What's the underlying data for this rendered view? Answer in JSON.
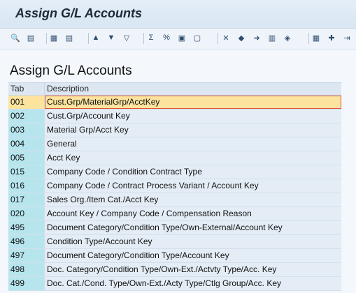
{
  "window": {
    "title": "Assign G/L Accounts"
  },
  "toolbar": {
    "buttons": [
      {
        "name": "details-icon",
        "glyph": "🔍"
      },
      {
        "name": "choose-icon",
        "glyph": "▤"
      },
      {
        "name": "print-icon",
        "glyph": "▦"
      },
      {
        "name": "find-icon",
        "glyph": "▤"
      },
      {
        "name": "sort-ascending-icon",
        "glyph": "▲"
      },
      {
        "name": "sort-descending-icon",
        "glyph": "▼"
      },
      {
        "name": "filter-icon",
        "glyph": "▽"
      },
      {
        "name": "sum-icon",
        "glyph": "Σ"
      },
      {
        "name": "subtotal-icon",
        "glyph": "%"
      },
      {
        "name": "layout-icon",
        "glyph": "▣"
      },
      {
        "name": "export-icon",
        "glyph": "▢"
      },
      {
        "name": "excel-icon",
        "glyph": "✕"
      },
      {
        "name": "graphic-icon",
        "glyph": "◆"
      },
      {
        "name": "send-icon",
        "glyph": "➜"
      },
      {
        "name": "word-processing-icon",
        "glyph": "▥"
      },
      {
        "name": "abc-analysis-icon",
        "glyph": "◈"
      },
      {
        "name": "grid-icon",
        "glyph": "▦"
      },
      {
        "name": "more-icon",
        "glyph": "✚"
      },
      {
        "name": "next-icon",
        "glyph": "⇥"
      }
    ]
  },
  "main": {
    "heading": "Assign G/L Accounts",
    "columns": [
      "Tab",
      "Description"
    ],
    "rows": [
      {
        "tab": "001",
        "description": "Cust.Grp/MaterialGrp/AcctKey",
        "selected": true
      },
      {
        "tab": "002",
        "description": "Cust.Grp/Account Key"
      },
      {
        "tab": "003",
        "description": "Material Grp/Acct Key"
      },
      {
        "tab": "004",
        "description": "General"
      },
      {
        "tab": "005",
        "description": "Acct Key"
      },
      {
        "tab": "015",
        "description": "Company Code / Condition Contract Type"
      },
      {
        "tab": "016",
        "description": "Company Code / Contract Process Variant / Account Key"
      },
      {
        "tab": "017",
        "description": "Sales Org./Item Cat./Acct Key"
      },
      {
        "tab": "020",
        "description": "Account Key / Company Code / Compensation Reason"
      },
      {
        "tab": "495",
        "description": "Document Category/Condition Type/Own-External/Account Key"
      },
      {
        "tab": "496",
        "description": "Condition Type/Account Key"
      },
      {
        "tab": "497",
        "description": "Document Category/Condition Type/Account Key"
      },
      {
        "tab": "498",
        "description": "Doc. Category/Condition Type/Own-Ext./Actvty Type/Acc. Key"
      },
      {
        "tab": "499",
        "description": "Doc. Cat./Cond. Type/Own-Ext./Acty Type/Ctlg Group/Acc. Key"
      }
    ]
  },
  "colors": {
    "tab_cell": "#b7e5ee",
    "desc_cell": "#e4edf6",
    "selected": "#fce39e",
    "selected_border": "#e0523b"
  }
}
